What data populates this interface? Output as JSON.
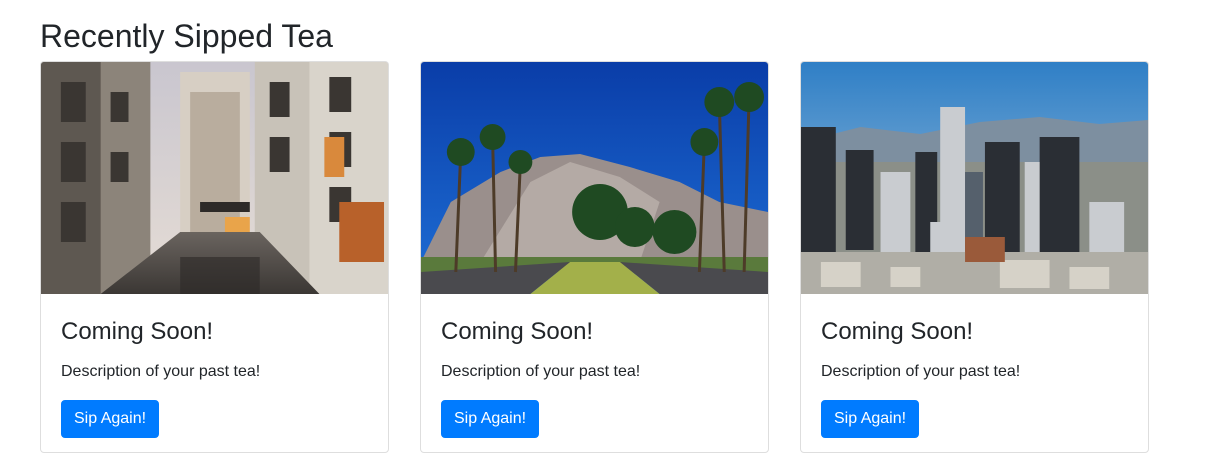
{
  "section": {
    "title": "Recently Sipped Tea"
  },
  "cards": [
    {
      "title": "Coming Soon!",
      "description": "Description of your past tea!",
      "button_label": "Sip Again!"
    },
    {
      "title": "Coming Soon!",
      "description": "Description of your past tea!",
      "button_label": "Sip Again!"
    },
    {
      "title": "Coming Soon!",
      "description": "Description of your past tea!",
      "button_label": "Sip Again!"
    }
  ],
  "colors": {
    "primary": "#007bff",
    "heading": "#212529",
    "card_border": "#dfdfdf"
  }
}
